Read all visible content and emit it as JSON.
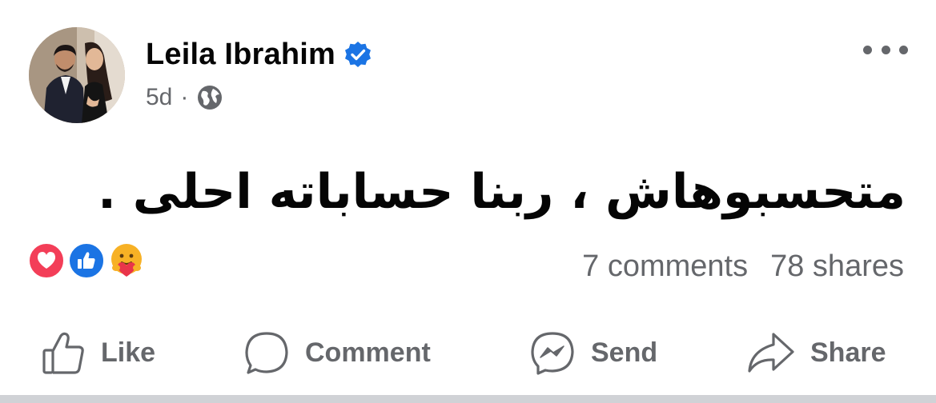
{
  "post": {
    "author": {
      "name": "Leila Ibrahim",
      "verified": true
    },
    "timestamp": "5d",
    "separator": "·",
    "audience_icon": "globe-icon",
    "text": "متحسبوهاش ، ربنا حساباته احلى .",
    "reactions": [
      {
        "name": "love",
        "icon": "heart-icon",
        "color": "#f33e58"
      },
      {
        "name": "like",
        "icon": "thumbs-up-icon",
        "color": "#1b74e4"
      },
      {
        "name": "care",
        "icon": "care-emoji-icon",
        "color": "#f7b125"
      }
    ],
    "comments": "7 comments",
    "shares": "78 shares"
  },
  "actions": {
    "like": "Like",
    "comment": "Comment",
    "send": "Send",
    "share": "Share"
  },
  "colors": {
    "secondary_text": "#65676b",
    "primary_text": "#050505",
    "verified_blue": "#1b74e4"
  }
}
